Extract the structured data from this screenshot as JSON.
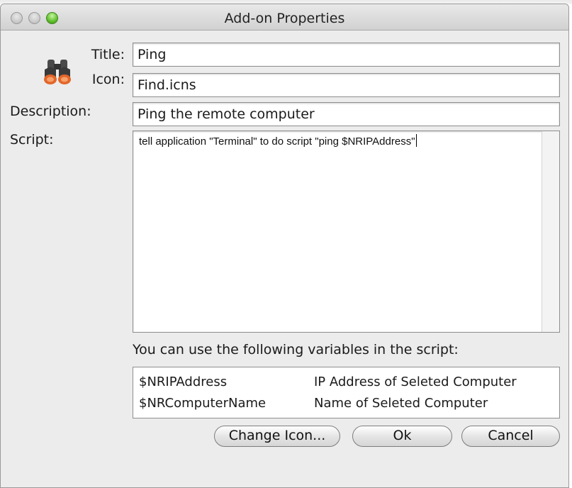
{
  "window": {
    "title": "Add-on Properties"
  },
  "form": {
    "title_label": "Title:",
    "title_value": "Ping",
    "icon_label": "Icon:",
    "icon_value": "Find.icns",
    "icon_name": "binoculars-icon",
    "description_label": "Description:",
    "description_value": "Ping the remote computer",
    "script_label": "Script:",
    "script_value": "tell application \"Terminal\" to do script \"ping $NRIPAddress\""
  },
  "variables": {
    "heading": "You can use the following variables in the script:",
    "rows": [
      {
        "name": "$NRIPAddress",
        "description": "IP Address of Seleted Computer"
      },
      {
        "name": "$NRComputerName",
        "description": "Name of Seleted Computer"
      }
    ]
  },
  "buttons": {
    "change_icon": "Change Icon...",
    "ok": "Ok",
    "cancel": "Cancel"
  },
  "colors": {
    "window_bg": "#ececec",
    "zoom_button": "#5fbf2c"
  }
}
